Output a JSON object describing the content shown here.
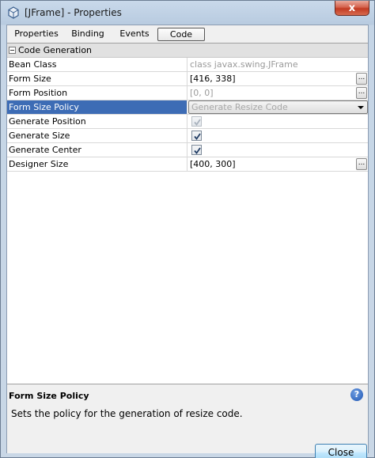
{
  "window": {
    "title": "[JFrame] - Properties",
    "close_glyph": "x",
    "icon": "netbeans-cube-icon"
  },
  "tabs": [
    {
      "label": "Properties",
      "active": false
    },
    {
      "label": "Binding",
      "active": false
    },
    {
      "label": "Events",
      "active": false
    },
    {
      "label": "Code",
      "active": true
    }
  ],
  "category": {
    "label": "Code Generation",
    "expanded": true
  },
  "properties": [
    {
      "name": "Bean Class",
      "value": "class javax.swing.JFrame",
      "kind": "text",
      "disabled": true,
      "ellipsis": false
    },
    {
      "name": "Form Size",
      "value": "[416, 338]",
      "kind": "text",
      "disabled": false,
      "ellipsis": true
    },
    {
      "name": "Form Position",
      "value": "[0, 0]",
      "kind": "text",
      "disabled": true,
      "ellipsis": true
    },
    {
      "name": "Form Size Policy",
      "value": "Generate Resize Code",
      "kind": "combo",
      "disabled": true,
      "selected": true
    },
    {
      "name": "Generate Position",
      "value": "",
      "kind": "checkbox",
      "checked": true,
      "disabled": true
    },
    {
      "name": "Generate Size",
      "value": "",
      "kind": "checkbox",
      "checked": true,
      "disabled": false
    },
    {
      "name": "Generate Center",
      "value": "",
      "kind": "checkbox",
      "checked": true,
      "disabled": false
    },
    {
      "name": "Designer Size",
      "value": "[400, 300]",
      "kind": "text",
      "disabled": false,
      "ellipsis": true
    }
  ],
  "ellipsis_label": "...",
  "description": {
    "title": "Form Size Policy",
    "text": "Sets the policy for the generation of resize code.",
    "help_glyph": "?"
  },
  "buttons": {
    "close_label": "Close"
  },
  "colors": {
    "selection": "#3d6cb5",
    "close_button_red": "#c23b22",
    "disabled_text": "#9a9a9a"
  }
}
